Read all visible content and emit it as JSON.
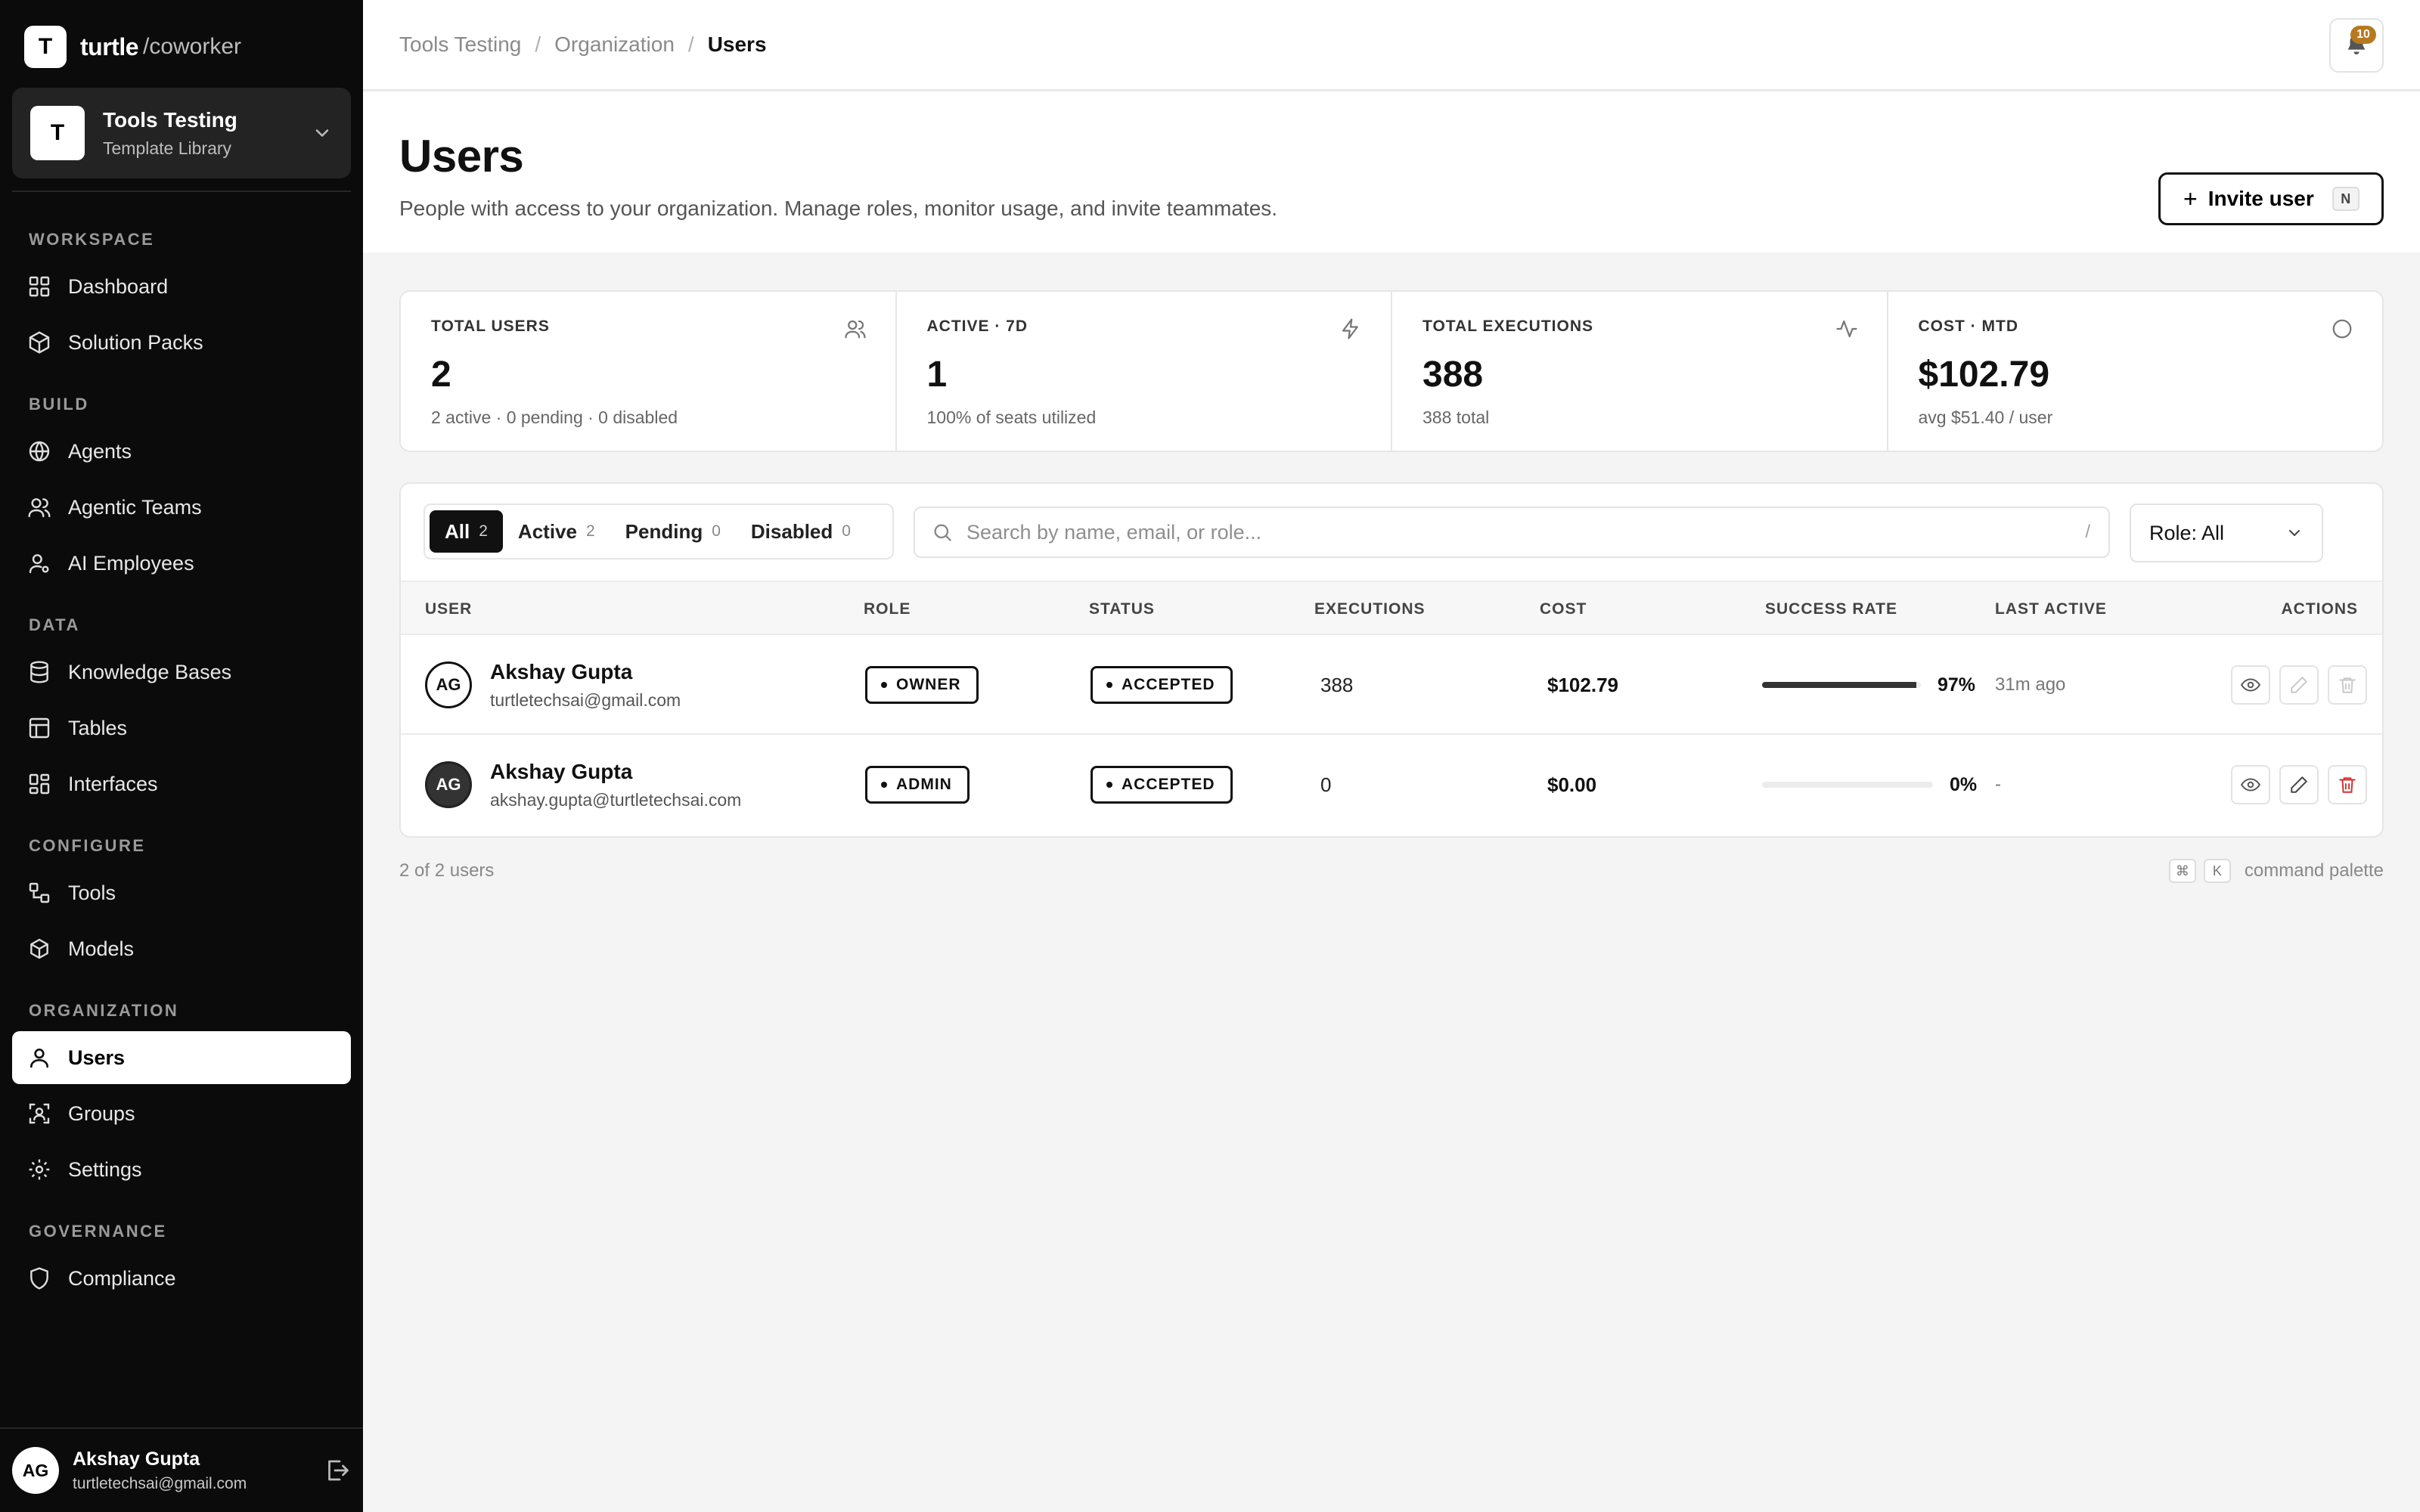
{
  "app": {
    "logo_mark": "T",
    "logo_word": "turtle",
    "logo_sub": "/coworker"
  },
  "org": {
    "avatar": "T",
    "name": "Tools Testing",
    "subtitle": "Template Library"
  },
  "nav": {
    "sections": [
      {
        "label": "WORKSPACE",
        "items": [
          {
            "label": "Dashboard",
            "icon": "grid-icon"
          },
          {
            "label": "Solution Packs",
            "icon": "box-icon"
          }
        ]
      },
      {
        "label": "BUILD",
        "items": [
          {
            "label": "Agents",
            "icon": "globe-icon"
          },
          {
            "label": "Agentic Teams",
            "icon": "users-icon"
          },
          {
            "label": "AI Employees",
            "icon": "user-gear-icon"
          }
        ]
      },
      {
        "label": "DATA",
        "items": [
          {
            "label": "Knowledge Bases",
            "icon": "database-icon"
          },
          {
            "label": "Tables",
            "icon": "table-icon"
          },
          {
            "label": "Interfaces",
            "icon": "layout-icon"
          }
        ]
      },
      {
        "label": "CONFIGURE",
        "items": [
          {
            "label": "Tools",
            "icon": "tools-icon"
          },
          {
            "label": "Models",
            "icon": "cube-icon"
          }
        ]
      },
      {
        "label": "ORGANIZATION",
        "items": [
          {
            "label": "Users",
            "icon": "user-icon",
            "active": true
          },
          {
            "label": "Groups",
            "icon": "group-icon"
          },
          {
            "label": "Settings",
            "icon": "gear-icon"
          }
        ]
      },
      {
        "label": "GOVERNANCE",
        "items": [
          {
            "label": "Compliance",
            "icon": "shield-icon"
          }
        ]
      }
    ]
  },
  "current_user": {
    "initials": "AG",
    "name": "Akshay Gupta",
    "email": "turtletechsai@gmail.com"
  },
  "breadcrumb": [
    "Tools Testing",
    "Organization",
    "Users"
  ],
  "notifications": {
    "count": "10"
  },
  "header": {
    "title": "Users",
    "subtitle": "People with access to your organization. Manage roles, monitor usage, and invite teammates.",
    "invite_label": "Invite user",
    "invite_shortcut": "N"
  },
  "stats": [
    {
      "label": "TOTAL USERS",
      "value": "2",
      "sub": "2 active · 0 pending · 0 disabled",
      "icon": "users-icon"
    },
    {
      "label": "ACTIVE · 7D",
      "value": "1",
      "sub": "100% of seats utilized",
      "icon": "bolt-icon"
    },
    {
      "label": "TOTAL EXECUTIONS",
      "value": "388",
      "sub": "388 total",
      "icon": "activity-icon"
    },
    {
      "label": "COST · MTD",
      "value": "$102.79",
      "sub": "avg $51.40 / user",
      "icon": "circle-icon"
    }
  ],
  "filters": {
    "tabs": [
      {
        "label": "All",
        "count": "2",
        "active": true
      },
      {
        "label": "Active",
        "count": "2"
      },
      {
        "label": "Pending",
        "count": "0"
      },
      {
        "label": "Disabled",
        "count": "0"
      }
    ],
    "search_placeholder": "Search by name, email, or role...",
    "search_shortcut": "/",
    "role_select": "Role: All"
  },
  "table": {
    "columns": [
      "USER",
      "ROLE",
      "STATUS",
      "EXECUTIONS",
      "COST",
      "SUCCESS RATE",
      "LAST ACTIVE",
      "ACTIONS"
    ],
    "rows": [
      {
        "initials": "AG",
        "name": "Akshay Gupta",
        "email": "turtletechsai@gmail.com",
        "role": "OWNER",
        "status": "ACCEPTED",
        "executions": "388",
        "cost": "$102.79",
        "success_rate": 0.97,
        "success_label": "97%",
        "last_active": "31m ago"
      },
      {
        "initials": "AG",
        "name": "Akshay Gupta",
        "email": "akshay.gupta@turtletechsai.com",
        "role": "ADMIN",
        "status": "ACCEPTED",
        "executions": "0",
        "cost": "$0.00",
        "success_rate": 0.0,
        "success_label": "0%",
        "last_active": "-"
      }
    ]
  },
  "footer": {
    "count_text": "2 of 2 users",
    "palette_key1": "⌘",
    "palette_key2": "K",
    "palette_label": "command palette"
  },
  "colors": {
    "sidebar_bg": "#0b0b0b",
    "accent": "#111111",
    "badge": "#b7791f",
    "danger": "#d32f2f"
  }
}
